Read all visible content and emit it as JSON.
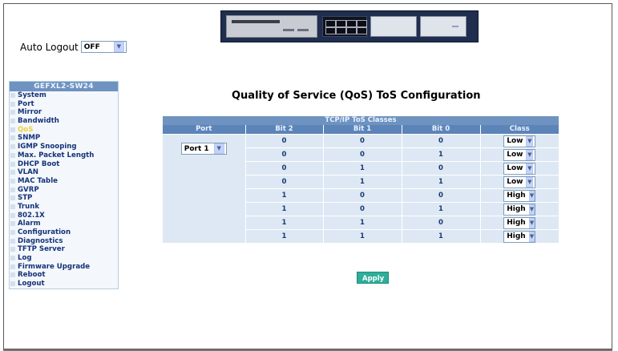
{
  "auto_logout": {
    "label": "Auto Logout",
    "value": "OFF"
  },
  "sidebar": {
    "title": "GEFXL2-SW24",
    "items": [
      {
        "label": "System"
      },
      {
        "label": "Port"
      },
      {
        "label": "Mirror"
      },
      {
        "label": "Bandwidth"
      },
      {
        "label": "QoS"
      },
      {
        "label": "SNMP"
      },
      {
        "label": "IGMP Snooping"
      },
      {
        "label": "Max. Packet Length"
      },
      {
        "label": "DHCP Boot"
      },
      {
        "label": "VLAN"
      },
      {
        "label": "MAC Table"
      },
      {
        "label": "GVRP"
      },
      {
        "label": "STP"
      },
      {
        "label": "Trunk"
      },
      {
        "label": "802.1X"
      },
      {
        "label": "Alarm"
      },
      {
        "label": "Configuration"
      },
      {
        "label": "Diagnostics"
      },
      {
        "label": "TFTP Server"
      },
      {
        "label": "Log"
      },
      {
        "label": "Firmware Upgrade"
      },
      {
        "label": "Reboot"
      },
      {
        "label": "Logout"
      }
    ],
    "active_index": 4
  },
  "main": {
    "title": "Quality of Service (QoS) ToS Configuration",
    "table": {
      "group_header": "TCP/IP ToS Classes",
      "columns": [
        "Port",
        "Bit 2",
        "Bit 1",
        "Bit 0",
        "Class"
      ],
      "port_value": "Port 1",
      "rows": [
        {
          "bit2": "0",
          "bit1": "0",
          "bit0": "0",
          "class": "Low"
        },
        {
          "bit2": "0",
          "bit1": "0",
          "bit0": "1",
          "class": "Low"
        },
        {
          "bit2": "0",
          "bit1": "1",
          "bit0": "0",
          "class": "Low"
        },
        {
          "bit2": "0",
          "bit1": "1",
          "bit0": "1",
          "class": "Low"
        },
        {
          "bit2": "1",
          "bit1": "0",
          "bit0": "0",
          "class": "High"
        },
        {
          "bit2": "1",
          "bit1": "0",
          "bit0": "1",
          "class": "High"
        },
        {
          "bit2": "1",
          "bit1": "1",
          "bit0": "0",
          "class": "High"
        },
        {
          "bit2": "1",
          "bit1": "1",
          "bit0": "1",
          "class": "High"
        }
      ]
    },
    "apply_label": "Apply"
  },
  "colors": {
    "sidebar_header": "#6f93c0",
    "table_header": "#5d84b8",
    "table_cell": "#dde8f4",
    "active_item": "#e8d23c",
    "apply_button": "#2fae9a"
  },
  "icons": {
    "select_arrow": "chevron-down-icon"
  }
}
